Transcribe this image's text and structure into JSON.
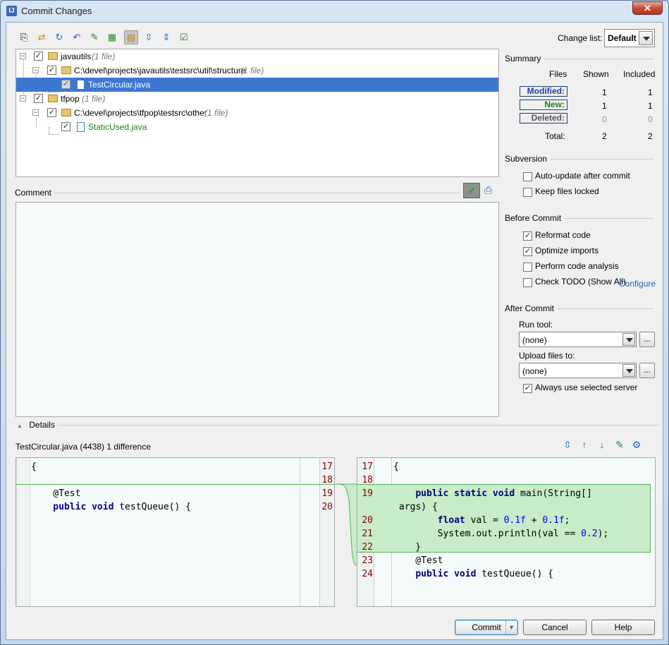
{
  "window": {
    "title": "Commit Changes",
    "close_glyph": "✕"
  },
  "toolbar": {
    "icons": [
      "show-diff-icon",
      "move-to-changelist-icon",
      "refresh-icon",
      "revert-icon",
      "edit-source-icon",
      "show-diff-window-icon",
      "group-by-directory-icon",
      "expand-all-icon",
      "collapse-all-icon",
      "select-all-icon"
    ],
    "changelist_label": "Change list:",
    "changelist_value": "Default"
  },
  "tree": {
    "rows": [
      {
        "name": "javautils",
        "note": "(1 file)"
      },
      {
        "name": "C:\\devel\\projects\\javautils\\testsrc\\util\\structure",
        "note": "(1 file)"
      },
      {
        "name": "TestCircular.java",
        "note": ""
      },
      {
        "name": "tfpop",
        "note": "(1 file)"
      },
      {
        "name": "C:\\devel\\projects\\tfpop\\testsrc\\other",
        "note": "(1 file)"
      },
      {
        "name": "StaticUsed.java",
        "note": ""
      }
    ]
  },
  "comment": {
    "label": "Comment",
    "value": ""
  },
  "summary": {
    "title": "Summary",
    "headers": {
      "files": "Files",
      "shown": "Shown",
      "included": "Included"
    },
    "rows": [
      {
        "label": "Modified:",
        "shown": "1",
        "included": "1",
        "color": "#1f3f9f"
      },
      {
        "label": "New:",
        "shown": "1",
        "included": "1",
        "color": "#1f7f1f"
      },
      {
        "label": "Deleted:",
        "shown": "0",
        "included": "0",
        "color": "#555555"
      }
    ],
    "total": {
      "label": "Total:",
      "shown": "2",
      "included": "2"
    }
  },
  "subversion": {
    "title": "Subversion",
    "auto_update": "Auto-update after commit",
    "keep_locked": "Keep files locked"
  },
  "before_commit": {
    "title": "Before Commit",
    "reformat": "Reformat code",
    "optimize": "Optimize imports",
    "analysis": "Perform code analysis",
    "todo": "Check TODO (Show All)",
    "configure": "Configure"
  },
  "after_commit": {
    "title": "After Commit",
    "run_tool_label": "Run tool:",
    "run_tool_value": "(none)",
    "upload_label": "Upload files to:",
    "upload_value": "(none)",
    "always_use": "Always use selected server",
    "dots": "..."
  },
  "details": {
    "title": "Details",
    "file_label": "TestCircular.java (4438) 1 difference",
    "left": {
      "lines": [
        {
          "text": "{",
          "num": "17"
        },
        {
          "text": "",
          "num": "18"
        },
        {
          "text": "    @Test",
          "num": "19"
        },
        {
          "text": "    public void testQueue() {",
          "num": "20"
        }
      ]
    },
    "right": {
      "nums": [
        "17",
        "18",
        "19",
        "20",
        "21",
        "22",
        "23",
        "24"
      ]
    }
  },
  "buttons": {
    "commit": "Commit",
    "cancel": "Cancel",
    "help": "Help"
  }
}
